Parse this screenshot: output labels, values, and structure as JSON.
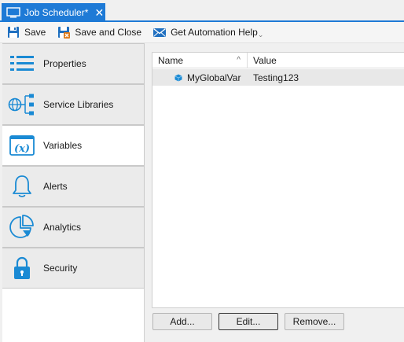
{
  "tab": {
    "title": "Job Scheduler*",
    "close_glyph": "✕",
    "icon": "monitor-icon"
  },
  "toolbar": {
    "save_label": "Save",
    "save_close_label": "Save and Close",
    "automation_help_label": "Get Automation Help",
    "overflow_glyph": "⌄"
  },
  "nav": {
    "items": [
      {
        "label": "Properties",
        "icon": "properties-list-icon"
      },
      {
        "label": "Service Libraries",
        "icon": "service-libraries-icon"
      },
      {
        "label": "Variables",
        "icon": "variables-icon",
        "active": true
      },
      {
        "label": "Alerts",
        "icon": "bell-icon"
      },
      {
        "label": "Analytics",
        "icon": "pie-chart-icon"
      },
      {
        "label": "Security",
        "icon": "lock-icon"
      }
    ]
  },
  "grid": {
    "columns": {
      "name": "Name",
      "value": "Value"
    },
    "sort_glyph": "^",
    "rows": [
      {
        "name": "MyGlobalVar",
        "value": "Testing123"
      }
    ]
  },
  "buttons": {
    "add": "Add...",
    "edit": "Edit...",
    "remove": "Remove..."
  },
  "colors": {
    "accent": "#1e7ad6",
    "icon_blue": "#1a8ad4",
    "selected_row": "#e8e8e8"
  }
}
